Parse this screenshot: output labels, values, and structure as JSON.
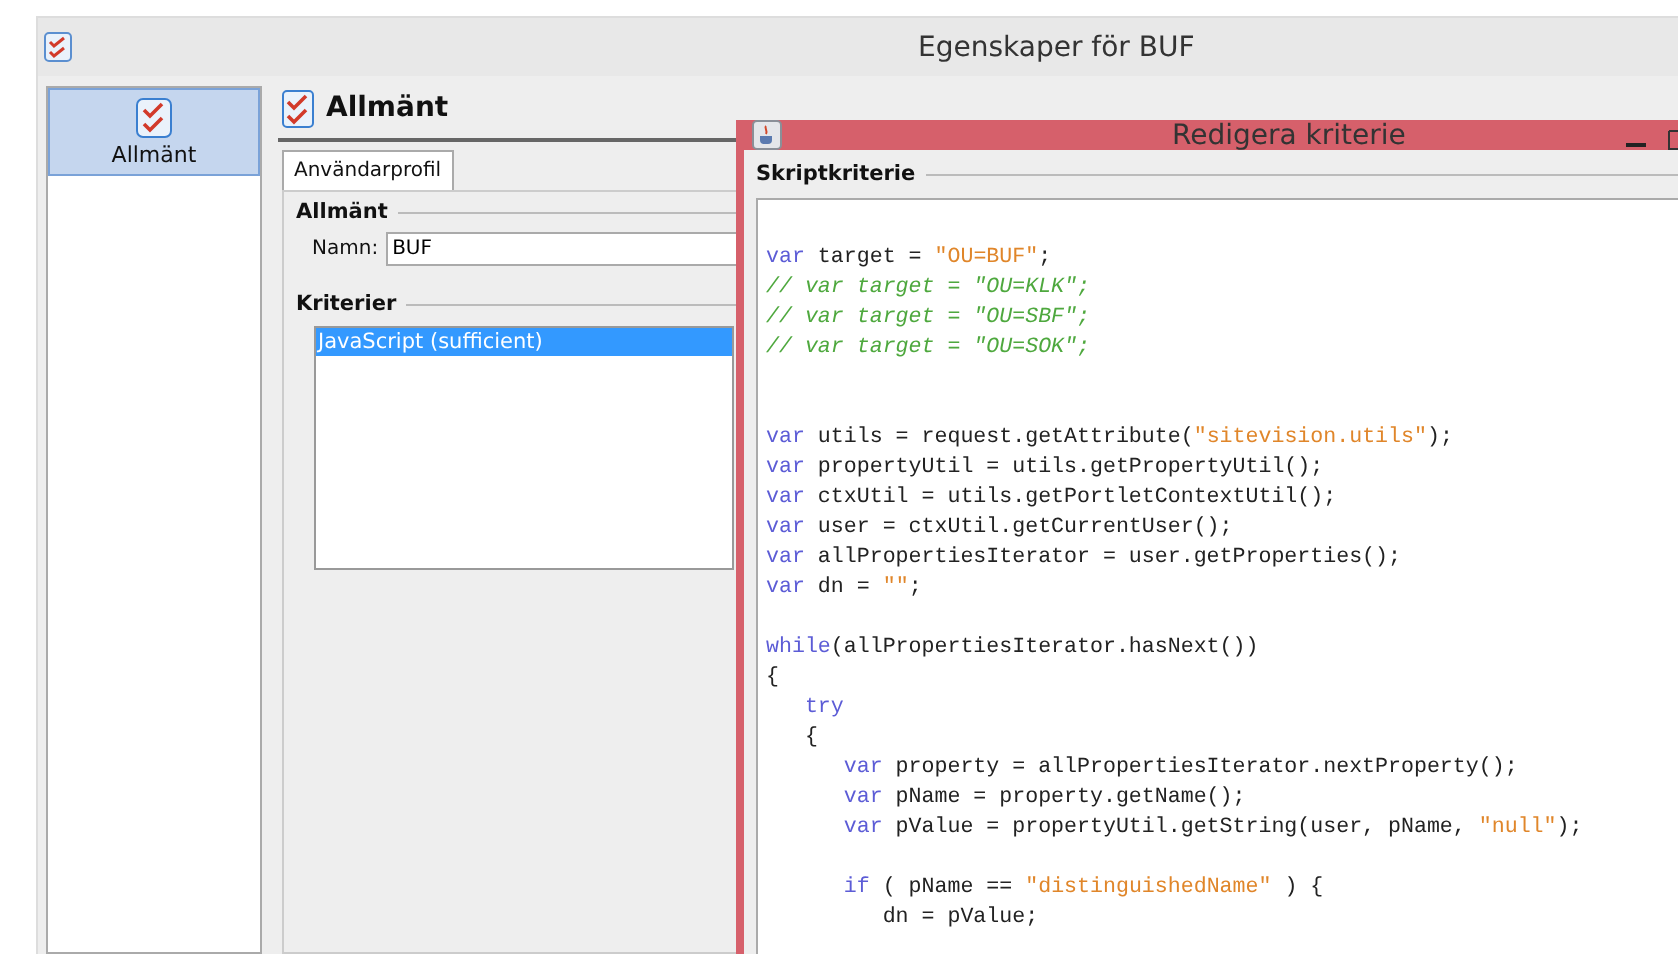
{
  "window": {
    "title": "Egenskaper för BUF"
  },
  "sidebar": {
    "items": [
      {
        "label": "Allmänt",
        "selected": true
      }
    ]
  },
  "header": {
    "title": "Allmänt"
  },
  "tabs": [
    {
      "label": "Användarprofil",
      "selected": true
    }
  ],
  "general": {
    "legend": "Allmänt",
    "name_label": "Namn:",
    "name_value": "BUF"
  },
  "criteria": {
    "legend": "Kriterier",
    "items": [
      {
        "label": "JavaScript (sufficient)",
        "selected": true
      }
    ]
  },
  "dialog": {
    "title": "Redigera kriterie",
    "legend": "Skriptkriterie",
    "lines": [
      {
        "kind": "blank"
      },
      {
        "kind": "code",
        "tokens": [
          {
            "kind": "keyword",
            "text": "var"
          },
          {
            "kind": "plain",
            "text": " target = "
          },
          {
            "kind": "string",
            "text": "\"OU=BUF\""
          },
          {
            "kind": "plain",
            "text": ";"
          }
        ]
      },
      {
        "kind": "code",
        "tokens": [
          {
            "kind": "comment",
            "text": "// var target = \"OU=KLK\";"
          }
        ]
      },
      {
        "kind": "code",
        "tokens": [
          {
            "kind": "comment",
            "text": "// var target = \"OU=SBF\";"
          }
        ]
      },
      {
        "kind": "code",
        "tokens": [
          {
            "kind": "comment",
            "text": "// var target = \"OU=SOK\";"
          }
        ]
      },
      {
        "kind": "blank"
      },
      {
        "kind": "blank"
      },
      {
        "kind": "code",
        "tokens": [
          {
            "kind": "keyword",
            "text": "var"
          },
          {
            "kind": "plain",
            "text": " utils = request.getAttribute("
          },
          {
            "kind": "string",
            "text": "\"sitevision.utils\""
          },
          {
            "kind": "plain",
            "text": ");"
          }
        ]
      },
      {
        "kind": "code",
        "tokens": [
          {
            "kind": "keyword",
            "text": "var"
          },
          {
            "kind": "plain",
            "text": " propertyUtil = utils.getPropertyUtil();"
          }
        ]
      },
      {
        "kind": "code",
        "tokens": [
          {
            "kind": "keyword",
            "text": "var"
          },
          {
            "kind": "plain",
            "text": " ctxUtil = utils.getPortletContextUtil();"
          }
        ]
      },
      {
        "kind": "code",
        "tokens": [
          {
            "kind": "keyword",
            "text": "var"
          },
          {
            "kind": "plain",
            "text": " user = ctxUtil.getCurrentUser();"
          }
        ]
      },
      {
        "kind": "code",
        "tokens": [
          {
            "kind": "keyword",
            "text": "var"
          },
          {
            "kind": "plain",
            "text": " allPropertiesIterator = user.getProperties();"
          }
        ]
      },
      {
        "kind": "code",
        "tokens": [
          {
            "kind": "keyword",
            "text": "var"
          },
          {
            "kind": "plain",
            "text": " dn = "
          },
          {
            "kind": "string",
            "text": "\"\""
          },
          {
            "kind": "plain",
            "text": ";"
          }
        ]
      },
      {
        "kind": "blank"
      },
      {
        "kind": "code",
        "tokens": [
          {
            "kind": "keyword",
            "text": "while"
          },
          {
            "kind": "plain",
            "text": "(allPropertiesIterator.hasNext())"
          }
        ]
      },
      {
        "kind": "code",
        "tokens": [
          {
            "kind": "plain",
            "text": "{"
          }
        ]
      },
      {
        "kind": "code",
        "tokens": [
          {
            "kind": "keyword",
            "text": "   try"
          }
        ]
      },
      {
        "kind": "code",
        "tokens": [
          {
            "kind": "plain",
            "text": "   {"
          }
        ]
      },
      {
        "kind": "code",
        "tokens": [
          {
            "kind": "keyword",
            "text": "      var"
          },
          {
            "kind": "plain",
            "text": " property = allPropertiesIterator.nextProperty();"
          }
        ]
      },
      {
        "kind": "code",
        "tokens": [
          {
            "kind": "keyword",
            "text": "      var"
          },
          {
            "kind": "plain",
            "text": " pName = property.getName();"
          }
        ]
      },
      {
        "kind": "code",
        "tokens": [
          {
            "kind": "keyword",
            "text": "      var"
          },
          {
            "kind": "plain",
            "text": " pValue = propertyUtil.getString(user, pName, "
          },
          {
            "kind": "string",
            "text": "\"null\""
          },
          {
            "kind": "plain",
            "text": ");"
          }
        ]
      },
      {
        "kind": "blank"
      },
      {
        "kind": "code",
        "tokens": [
          {
            "kind": "keyword",
            "text": "      if"
          },
          {
            "kind": "plain",
            "text": " ( pName == "
          },
          {
            "kind": "string",
            "text": "\"distinguishedName\""
          },
          {
            "kind": "plain",
            "text": " ) {"
          }
        ]
      },
      {
        "kind": "code",
        "tokens": [
          {
            "kind": "plain",
            "text": "         dn = pValue;"
          }
        ]
      }
    ]
  }
}
